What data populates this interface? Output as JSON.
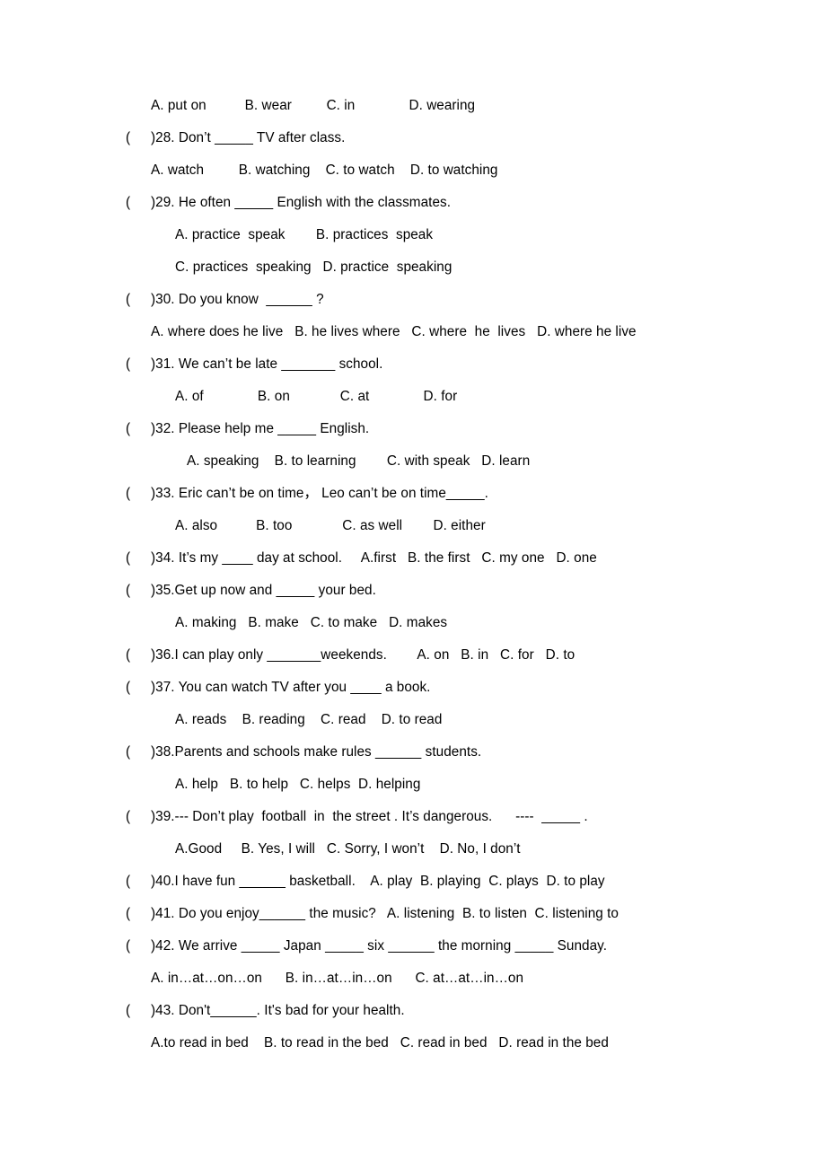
{
  "document": {
    "type": "worksheet",
    "subject": "English grammar multiple choice",
    "page_background": "#ffffff",
    "text_color": "#000000"
  },
  "lines": [
    {
      "kind": "answers",
      "indent": 28,
      "name": "answers-27",
      "text": "A. put on          B. wear         C. in              D. wearing"
    },
    {
      "kind": "question",
      "name": "question-28",
      "open": "(",
      "text": ")28. Don’t _____ TV after class."
    },
    {
      "kind": "answers",
      "indent": 28,
      "name": "answers-28",
      "text": "A. watch         B. watching    C. to watch    D. to watching"
    },
    {
      "kind": "question",
      "name": "question-29",
      "open": "(",
      "text": ")29. He often _____ English with the classmates."
    },
    {
      "kind": "answers",
      "indent": 55,
      "name": "answers-29-ab",
      "text": "A. practice  speak        B. practices  speak"
    },
    {
      "kind": "answers",
      "indent": 55,
      "name": "answers-29-cd",
      "text": "C. practices  speaking   D. practice  speaking"
    },
    {
      "kind": "question",
      "name": "question-30",
      "open": "(",
      "text": ")30. Do you know  ______ ?"
    },
    {
      "kind": "answers",
      "indent": 28,
      "name": "answers-30",
      "text": "A. where does he live   B. he lives where   C. where  he  lives   D. where he live"
    },
    {
      "kind": "question",
      "name": "question-31",
      "open": "(",
      "text": ")31. We can’t be late _______ school."
    },
    {
      "kind": "answers",
      "indent": 55,
      "name": "answers-31",
      "text": "A. of              B. on             C. at              D. for"
    },
    {
      "kind": "question",
      "name": "question-32",
      "open": "(",
      "text": ")32. Please help me _____ English."
    },
    {
      "kind": "answers",
      "indent": 68,
      "name": "answers-32",
      "text": "A. speaking    B. to learning        C. with speak   D. learn"
    },
    {
      "kind": "question",
      "name": "question-33",
      "open": "(",
      "text": ")33. Eric can’t be on time， Leo can’t be on time_____."
    },
    {
      "kind": "answers",
      "indent": 55,
      "name": "answers-33",
      "text": "A. also          B. too             C. as well        D. either"
    },
    {
      "kind": "question",
      "name": "question-34",
      "open": "(",
      "text": ")34. It’s my ____ day at school.     A.first   B. the first   C. my one   D. one"
    },
    {
      "kind": "question",
      "name": "question-35",
      "open": "(",
      "text": ")35.Get up now and _____ your bed."
    },
    {
      "kind": "answers",
      "indent": 55,
      "name": "answers-35",
      "text": "A. making   B. make   C. to make   D. makes"
    },
    {
      "kind": "question",
      "name": "question-36",
      "open": "(",
      "text": ")36.I can play only _______weekends.        A. on   B. in   C. for   D. to"
    },
    {
      "kind": "question",
      "name": "question-37",
      "open": "(",
      "text": ")37. You can watch TV after you ____ a book."
    },
    {
      "kind": "answers",
      "indent": 55,
      "name": "answers-37",
      "text": "A. reads    B. reading    C. read    D. to read"
    },
    {
      "kind": "question",
      "name": "question-38",
      "open": "(",
      "text": ")38.Parents and schools make rules ______ students."
    },
    {
      "kind": "answers",
      "indent": 55,
      "name": "answers-38",
      "text": "A. help   B. to help   C. helps  D. helping"
    },
    {
      "kind": "question",
      "name": "question-39",
      "open": "(",
      "text": ")39.--- Don’t play  football  in  the street . It’s dangerous.      ----  _____ ."
    },
    {
      "kind": "answers",
      "indent": 55,
      "name": "answers-39",
      "text": "A.Good     B. Yes, I will   C. Sorry, I won’t    D. No, I don’t"
    },
    {
      "kind": "question",
      "name": "question-40",
      "open": "(",
      "text": ")40.I have fun ______ basketball.    A. play  B. playing  C. plays  D. to play"
    },
    {
      "kind": "question",
      "name": "question-41",
      "open": "(",
      "text": ")41. Do you enjoy______ the music?   A. listening  B. to listen  C. listening to"
    },
    {
      "kind": "question",
      "name": "question-42",
      "open": "(",
      "text": ")42. We arrive _____ Japan _____ six ______ the morning _____ Sunday."
    },
    {
      "kind": "answers",
      "indent": 28,
      "name": "answers-42",
      "text": "A. in…at…on…on      B. in…at…in…on      C. at…at…in…on"
    },
    {
      "kind": "question",
      "name": "question-43",
      "open": "(",
      "text": ")43. Don't______. It's bad for your health."
    },
    {
      "kind": "answers",
      "indent": 28,
      "name": "answers-43",
      "text": "A.to read in bed    B. to read in the bed   C. read in bed   D. read in the bed"
    }
  ]
}
